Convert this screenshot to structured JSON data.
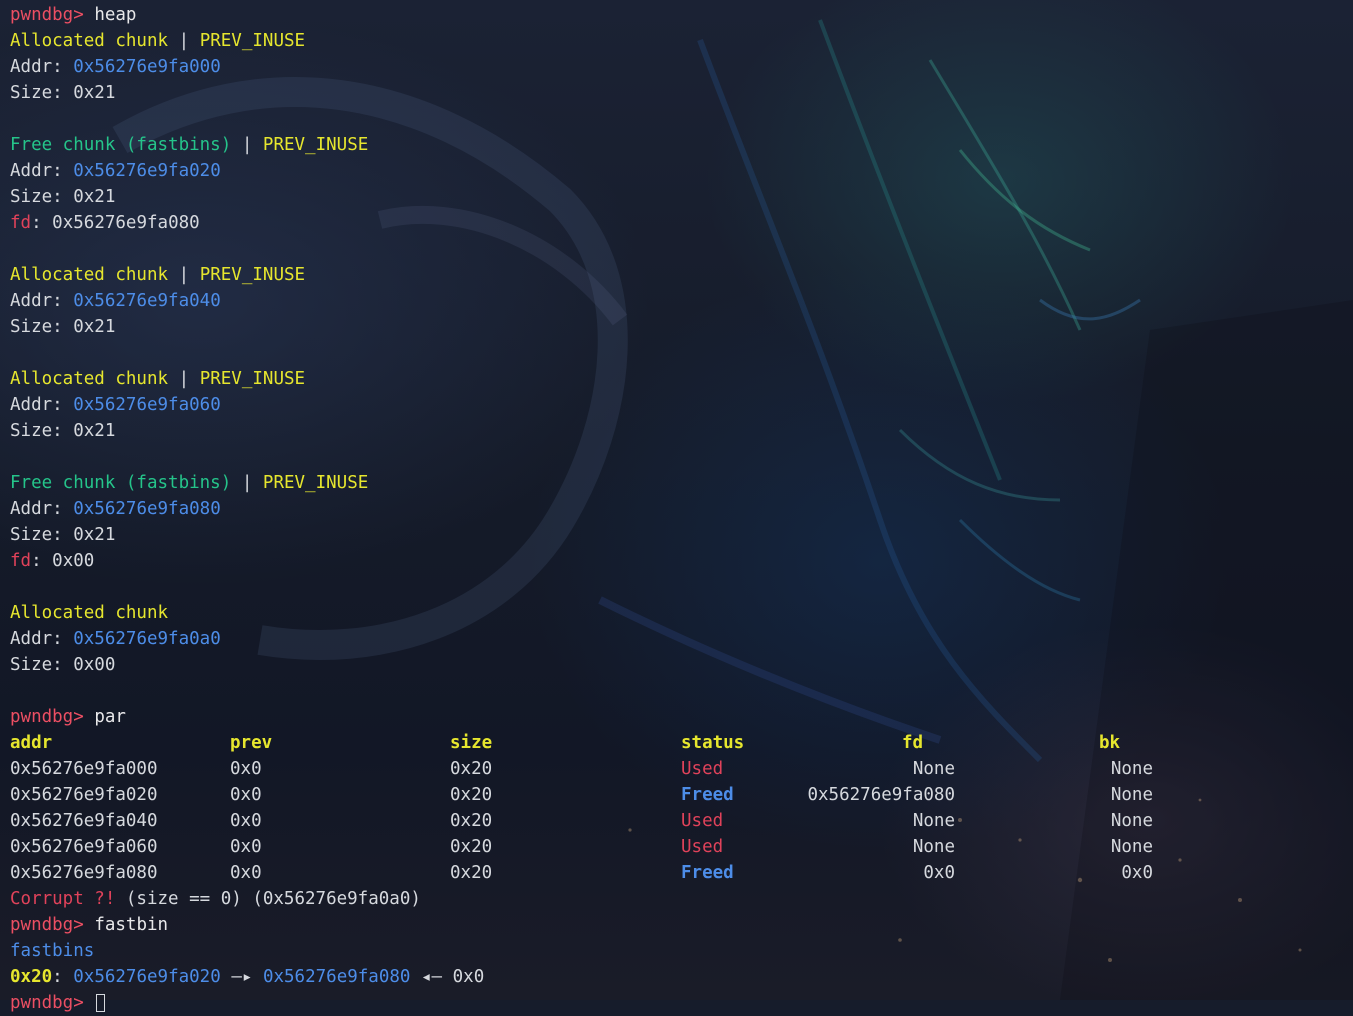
{
  "colors": {
    "prompt": "#ec4f63",
    "allocated": "#e6e62e",
    "free": "#25c48a",
    "address": "#4d8de8",
    "used": "#e0425a",
    "freed": "#4d8de8",
    "text": "#d6d9de"
  },
  "prompt": "pwndbg>",
  "commands": {
    "heap": "heap",
    "par": "par",
    "fastbin": "fastbin"
  },
  "labels": {
    "addr": "Addr:",
    "size": "Size:",
    "fd": "fd",
    "fd_colon": ":",
    "pipe": "|",
    "prev_inuse": "PREV_INUSE",
    "allocated_chunk": "Allocated chunk",
    "free_chunk": "Free chunk (fastbins)"
  },
  "heap_chunks": [
    {
      "status": "Allocated chunk",
      "prev_inuse": true,
      "addr": "0x56276e9fa000",
      "size": "0x21"
    },
    {
      "status": "Free chunk (fastbins)",
      "prev_inuse": true,
      "addr": "0x56276e9fa020",
      "size": "0x21",
      "fd": "0x56276e9fa080"
    },
    {
      "status": "Allocated chunk",
      "prev_inuse": true,
      "addr": "0x56276e9fa040",
      "size": "0x21"
    },
    {
      "status": "Allocated chunk",
      "prev_inuse": true,
      "addr": "0x56276e9fa060",
      "size": "0x21"
    },
    {
      "status": "Free chunk (fastbins)",
      "prev_inuse": true,
      "addr": "0x56276e9fa080",
      "size": "0x21",
      "fd": "0x00"
    },
    {
      "status": "Allocated chunk",
      "prev_inuse": false,
      "addr": "0x56276e9fa0a0",
      "size": "0x00"
    }
  ],
  "par_table": {
    "headers": [
      "addr",
      "prev",
      "size",
      "status",
      "fd",
      "bk"
    ],
    "rows": [
      {
        "addr": "0x56276e9fa000",
        "prev": "0x0",
        "size": "0x20",
        "status": "Used",
        "fd": "None",
        "bk": "None"
      },
      {
        "addr": "0x56276e9fa020",
        "prev": "0x0",
        "size": "0x20",
        "status": "Freed",
        "fd": "0x56276e9fa080",
        "bk": "None"
      },
      {
        "addr": "0x56276e9fa040",
        "prev": "0x0",
        "size": "0x20",
        "status": "Used",
        "fd": "None",
        "bk": "None"
      },
      {
        "addr": "0x56276e9fa060",
        "prev": "0x0",
        "size": "0x20",
        "status": "Used",
        "fd": "None",
        "bk": "None"
      },
      {
        "addr": "0x56276e9fa080",
        "prev": "0x0",
        "size": "0x20",
        "status": "Freed",
        "fd": "0x0",
        "bk": "0x0"
      }
    ],
    "corrupt": {
      "prefix": "Corrupt ?!",
      "rest": " (size == 0) (0x56276e9fa0a0)"
    }
  },
  "fastbins": {
    "title": "fastbins",
    "bin_size": "0x20",
    "colon": ":",
    "chain": [
      "0x56276e9fa020",
      "0x56276e9fa080"
    ],
    "arrow": "—▸",
    "end_arrow": "◂—",
    "end": "0x0"
  }
}
